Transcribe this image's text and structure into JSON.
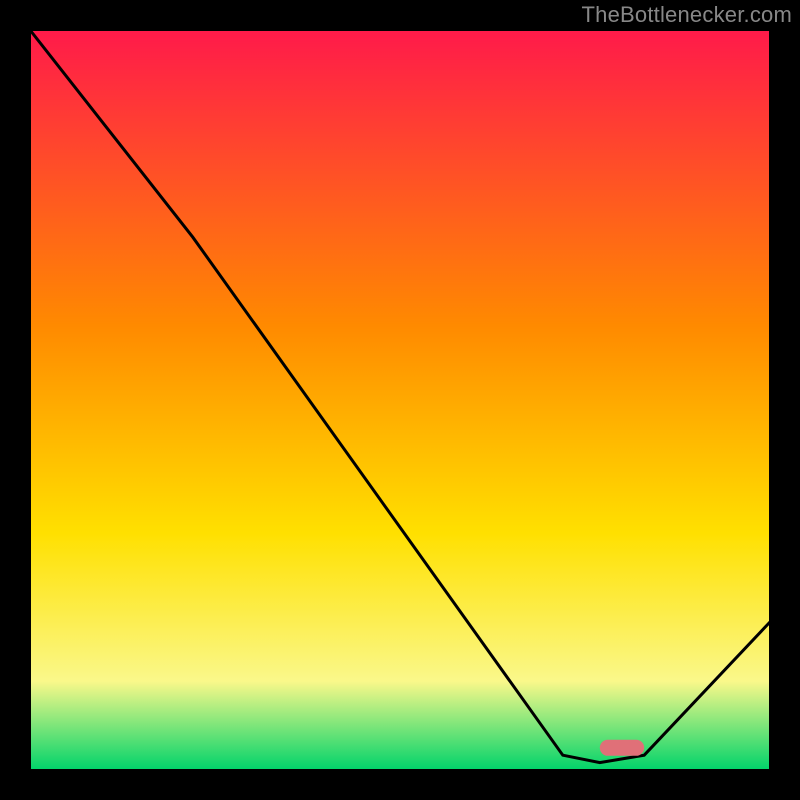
{
  "attribution": "TheBottlenecker.com",
  "chart_data": {
    "type": "line",
    "title": "",
    "xlabel": "",
    "ylabel": "",
    "xlim": [
      0,
      100
    ],
    "ylim": [
      0,
      100
    ],
    "series": [
      {
        "name": "curve",
        "x": [
          0,
          22,
          72,
          77,
          83,
          100
        ],
        "values": [
          100,
          72,
          2,
          1,
          2,
          20
        ]
      }
    ],
    "marker": {
      "x_start": 77,
      "x_end": 83,
      "y": 3
    },
    "colors": {
      "gradient_top": "#ff1a4a",
      "gradient_mid1": "#ff8a00",
      "gradient_mid2": "#ffe000",
      "gradient_mid3": "#faf88a",
      "gradient_bottom": "#00d36a",
      "curve": "#000000",
      "marker": "#e07078",
      "frame": "#000000"
    }
  }
}
